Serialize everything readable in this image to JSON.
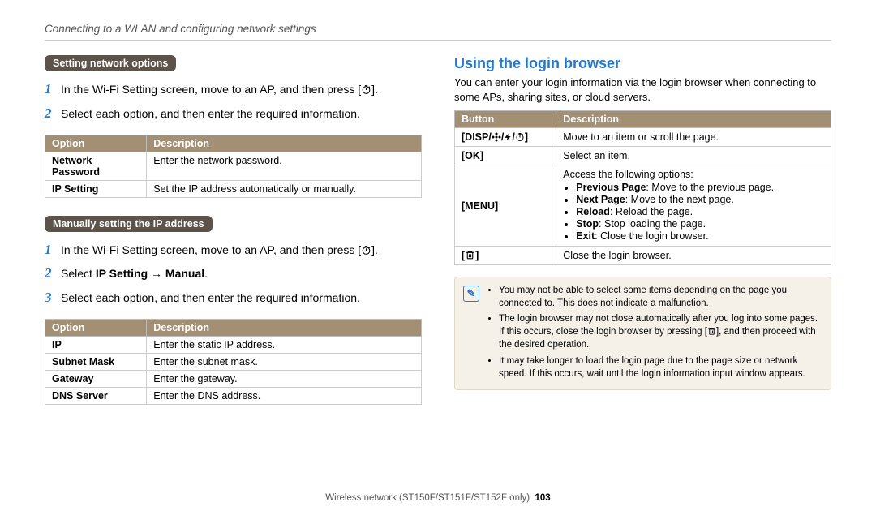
{
  "header": "Connecting to a WLAN and configuring network settings",
  "pill1": "Setting network options",
  "left_steps_a": [
    {
      "num": "1",
      "html": "In the Wi-Fi Setting screen, move to an AP, and then press [<svg class='icon-timer' width='13' height='13' viewBox='0 0 24 24' fill='none' stroke='black' stroke-width='2'><circle cx='12' cy='13' r='8'/><line x1='12' y1='13' x2='12' y2='8'/><line x1='9' y1='3' x2='15' y2='3'/><line x1='18' y1='5' x2='20' y2='7'/></svg>]."
    },
    {
      "num": "2",
      "html": "Select each option, and then enter the required information."
    }
  ],
  "table1": {
    "headers": [
      "Option",
      "Description"
    ],
    "rows": [
      [
        "Network Password",
        "Enter the network password."
      ],
      [
        "IP Setting",
        "Set the IP address automatically or manually."
      ]
    ]
  },
  "pill2": "Manually setting the IP address",
  "left_steps_b": [
    {
      "num": "1",
      "html": "In the Wi-Fi Setting screen, move to an AP, and then press [<svg class='icon-timer' width='13' height='13' viewBox='0 0 24 24' fill='none' stroke='black' stroke-width='2'><circle cx='12' cy='13' r='8'/><line x1='12' y1='13' x2='12' y2='8'/><line x1='9' y1='3' x2='15' y2='3'/><line x1='18' y1='5' x2='20' y2='7'/></svg>]."
    },
    {
      "num": "2",
      "html": "Select <b>IP Setting</b> → <b>Manual</b>."
    },
    {
      "num": "3",
      "html": "Select each option, and then enter the required information."
    }
  ],
  "table2": {
    "headers": [
      "Option",
      "Description"
    ],
    "rows": [
      [
        "IP",
        "Enter the static IP address."
      ],
      [
        "Subnet Mask",
        "Enter the subnet mask."
      ],
      [
        "Gateway",
        "Enter the gateway."
      ],
      [
        "DNS Server",
        "Enter the DNS address."
      ]
    ]
  },
  "right_title": "Using the login browser",
  "right_intro": "You can enter your login information via the login browser when connecting to some APs, sharing sites, or cloud servers.",
  "table3": {
    "headers": [
      "Button",
      "Description"
    ],
    "rows": [
      {
        "btn_html": "[<b>DISP</b>/<svg class='icon-flower' width='12' height='12' viewBox='0 0 24 24' fill='black'><circle cx='12' cy='12' r='3'/><circle cx='12' cy='4' r='3'/><circle cx='12' cy='20' r='3'/><circle cx='4' cy='12' r='3'/><circle cx='20' cy='12' r='3'/></svg>/<svg class='icon-flash' width='10' height='12' viewBox='0 0 24 24' fill='black'><polygon points='13 2 3 14 11 14 9 22 21 10 13 10 13 2'/></svg>/<svg class='icon-timer' width='12' height='12' viewBox='0 0 24 24' fill='none' stroke='black' stroke-width='2'><circle cx='12' cy='13' r='8'/><line x1='12' y1='13' x2='12' y2='8'/><line x1='9' y1='3' x2='15' y2='3'/><line x1='18' y1='5' x2='20' y2='7'/></svg>]",
        "desc_html": "Move to an item or scroll the page."
      },
      {
        "btn_html": "[<b>OK</b>]",
        "desc_html": "Select an item."
      },
      {
        "btn_html": "[<b>MENU</b>]",
        "desc_html": "Access the following options:<ul><li><b>Previous Page</b>: Move to the previous page.</li><li><b>Next Page</b>: Move to the next page.</li><li><b>Reload</b>: Reload the page.</li><li><b>Stop</b>: Stop loading the page.</li><li><b>Exit</b>: Close the login browser.</li></ul>"
      },
      {
        "btn_html": "[<svg class='icon-trash' width='13' height='13' viewBox='0 0 24 24' fill='none' stroke='black' stroke-width='2'><polyline points='3 6 5 6 21 6'/><path d='M8 6V4h8v2'/><rect x='6' y='6' width='12' height='14' rx='1'/><line x1='10' y1='10' x2='10' y2='17'/><line x1='14' y1='10' x2='14' y2='17'/></svg>]",
        "desc_html": "Close the login browser."
      }
    ]
  },
  "notes": [
    "You may not be able to select some items depending on the page you connected to. This does not indicate a malfunction.",
    "The login browser may not close automatically after you log into some pages. If this occurs, close the login browser by pressing [<svg class='icon-trash' width='11' height='11' viewBox='0 0 24 24' fill='none' stroke='black' stroke-width='2'><polyline points='3 6 5 6 21 6'/><path d='M8 6V4h8v2'/><rect x='6' y='6' width='12' height='14' rx='1'/><line x1='10' y1='10' x2='10' y2='17'/><line x1='14' y1='10' x2='14' y2='17'/></svg>], and then proceed with the desired operation.",
    "It may take longer to load the login page due to the page size or network speed. If this occurs, wait until the login information input window appears."
  ],
  "footer_text": "Wireless network  (ST150F/ST151F/ST152F only)",
  "page_number": "103"
}
